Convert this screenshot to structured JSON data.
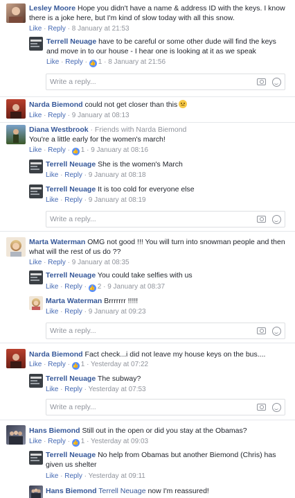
{
  "labels": {
    "like": "Like",
    "reply": "Reply",
    "dot": "·",
    "write_reply": "Write a reply..."
  },
  "colors": {
    "name_link": "#365899",
    "action_link": "#4267b2",
    "meta_gray": "#90949c",
    "like_badge": "#5890ff"
  },
  "comments": [
    {
      "id": "c1",
      "author": "Lesley Moore",
      "text_line1": "Hope you didn't have a name & address ID with the keys. I know",
      "text_line2": "there is a joke here, but I'm kind of slow today with all this snow.",
      "time": "8 January at 21:53",
      "avatar_icon": "avatar-photo-woman",
      "replies": [
        {
          "author": "Terrell Neuage",
          "text_line1": "have to be careful or some other dude will find the keys",
          "text_line2": "and move in to our house - I hear one is looking at it as we speak",
          "likes": "1",
          "time": "8 January at 21:56",
          "avatar_icon": "avatar-logo-newspaper"
        }
      ]
    },
    {
      "id": "c2",
      "author": "Narda Biemond",
      "text": "could not get closer than this",
      "emoji_icon": "smiling-face-emoji-icon",
      "time": "9 January at 08:13",
      "avatar_icon": "avatar-photo-red"
    },
    {
      "id": "c3",
      "author": "Diana Westbrook",
      "friends_note": "· Friends with Narda Biemond",
      "text": "You're a little early for the women's march!",
      "likes": "1",
      "time": "9 January at 08:16",
      "avatar_icon": "avatar-photo-outdoor",
      "replies": [
        {
          "author": "Terrell Neuage",
          "text": "She is the women's March",
          "time": "9 January at 08:18",
          "avatar_icon": "avatar-logo-newspaper"
        },
        {
          "author": "Terrell Neuage",
          "text": "It is too cold for everyone else",
          "time": "9 January at 08:19",
          "avatar_icon": "avatar-logo-newspaper"
        }
      ]
    },
    {
      "id": "c4",
      "author": "Marta Waterman",
      "text_line1": "OMG not good !!! You will turn into snowman people and then",
      "text_line2": "what will the rest of us do ??",
      "time": "9 January at 08:35",
      "avatar_icon": "avatar-photo-blonde",
      "replies": [
        {
          "author": "Terrell Neuage",
          "text": "You could take selfies with us",
          "likes": "2",
          "time": "9 January at 08:37",
          "avatar_icon": "avatar-logo-newspaper"
        },
        {
          "author": "Marta Waterman",
          "text": "Brrrrrrr !!!!!",
          "time": "9 January at 09:23",
          "avatar_icon": "avatar-photo-blonde"
        }
      ]
    },
    {
      "id": "c5",
      "author": "Narda Biemond",
      "text": "Fact check...i did not leave my house keys on the bus....",
      "likes": "1",
      "time": "Yesterday at 07:22",
      "avatar_icon": "avatar-photo-red",
      "replies": [
        {
          "author": "Terrell Neuage",
          "text": "The subway?",
          "time": "Yesterday at 07:53",
          "avatar_icon": "avatar-logo-newspaper"
        }
      ]
    },
    {
      "id": "c6",
      "author": "Hans Biemond",
      "text": "Still out in the open or did you stay at the Obamas?",
      "likes": "1",
      "time": "Yesterday at 09:03",
      "avatar_icon": "avatar-photo-group",
      "replies": [
        {
          "author": "Terrell Neuage",
          "text_line1": "No help from Obamas but another Biemond (Chris) has",
          "text_line2": "given us shelter",
          "time": "Yesterday at 09:11",
          "avatar_icon": "avatar-logo-newspaper"
        },
        {
          "author": "Hans Biemond",
          "mention": "Terrell Neuage",
          "text": "now I'm reassured!",
          "avatar_icon": "avatar-photo-group"
        }
      ]
    }
  ]
}
